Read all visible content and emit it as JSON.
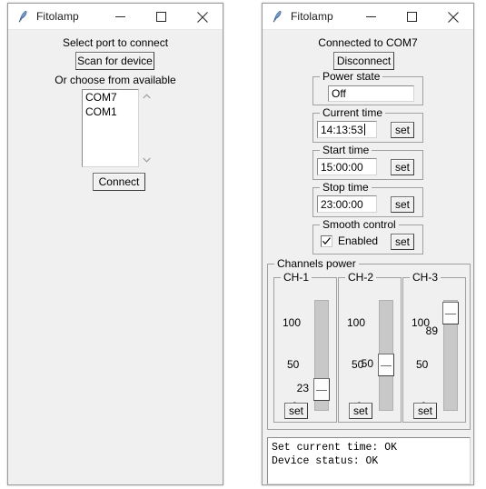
{
  "scan_window": {
    "title": "Fitolamp",
    "icon": "feather-icon",
    "titlebar": {
      "minimize": "minimize-icon",
      "maximize": "maximize-icon",
      "close": "close-icon"
    },
    "prompt": "Select port to connect",
    "scan_button": "Scan for device",
    "choose_label": "Or choose from available",
    "ports": [
      "COM7",
      "COM1"
    ],
    "connect_button": "Connect"
  },
  "control_window": {
    "title": "Fitolamp",
    "icon": "feather-icon",
    "titlebar": {
      "minimize": "minimize-icon",
      "maximize": "maximize-icon",
      "close": "close-icon"
    },
    "status": "Connected to COM7",
    "disconnect_button": "Disconnect",
    "power_state": {
      "legend": "Power state",
      "value": "Off"
    },
    "current_time": {
      "legend": "Current time",
      "value": "14:13:53",
      "set_button": "set"
    },
    "start_time": {
      "legend": "Start time",
      "value": "15:00:00",
      "set_button": "set"
    },
    "stop_time": {
      "legend": "Stop time",
      "value": "23:00:00",
      "set_button": "set"
    },
    "smooth_control": {
      "legend": "Smooth control",
      "checkbox_label": "Enabled",
      "checked": true,
      "set_button": "set"
    },
    "channels_power": {
      "legend": "Channels power",
      "tick_labels": [
        "100",
        "50",
        "0"
      ],
      "channels": [
        {
          "legend": "CH-1",
          "value": "23",
          "set_button": "set"
        },
        {
          "legend": "CH-2",
          "value": "50",
          "set_button": "set"
        },
        {
          "legend": "CH-3",
          "value": "89",
          "set_button": "set"
        }
      ]
    },
    "log": {
      "lines": [
        "Set current time: OK",
        "Device status: OK"
      ]
    }
  },
  "colors": {
    "window_face": "#f0f0f0",
    "entry_bg": "#ffffff",
    "trough": "#c8c8c8",
    "border": "#a0a0a0"
  }
}
